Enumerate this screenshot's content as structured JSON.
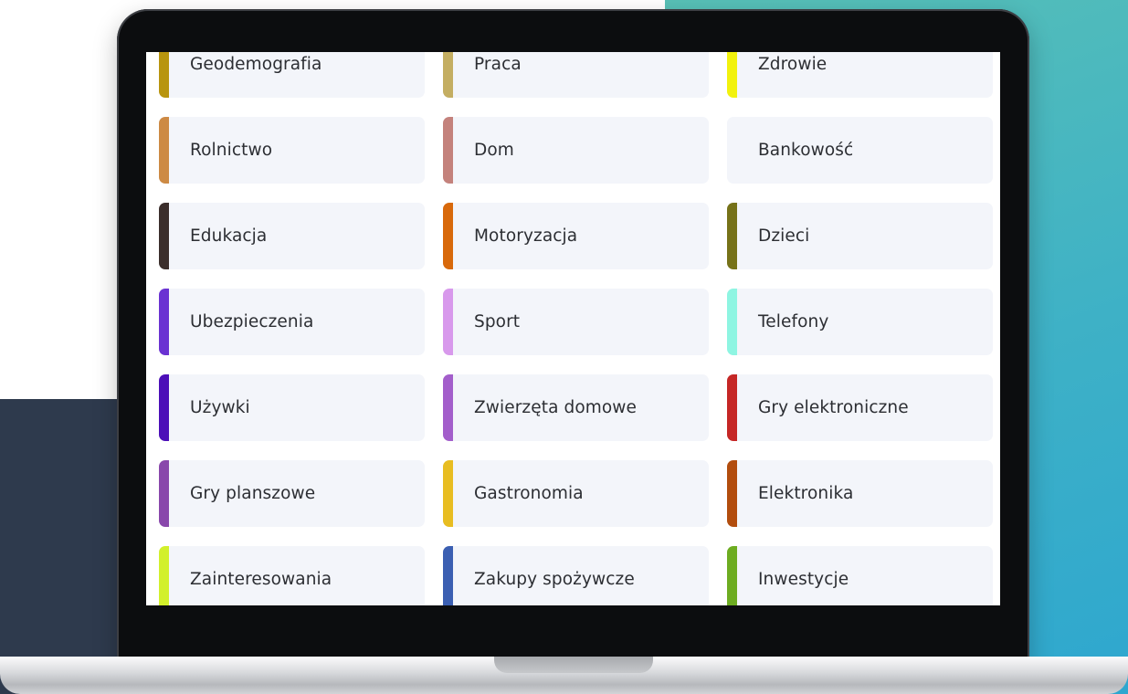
{
  "categories": [
    {
      "label": "Geodemografia",
      "color": "#b8950f"
    },
    {
      "label": "Praca",
      "color": "#c4ae62"
    },
    {
      "label": "Zdrowie",
      "color": "#f2f20e"
    },
    {
      "label": "Rolnictwo",
      "color": "#cd8a44"
    },
    {
      "label": "Dom",
      "color": "#c4827c"
    },
    {
      "label": "Bankowość",
      "color": ""
    },
    {
      "label": "Edukacja",
      "color": "#3b2e2b"
    },
    {
      "label": "Motoryzacja",
      "color": "#d8690b"
    },
    {
      "label": "Dzieci",
      "color": "#767219"
    },
    {
      "label": "Ubezpieczenia",
      "color": "#6a32d2"
    },
    {
      "label": "Sport",
      "color": "#d899ec"
    },
    {
      "label": "Telefony",
      "color": "#8ef5e2"
    },
    {
      "label": "Używki",
      "color": "#4c0fb8"
    },
    {
      "label": "Zwierzęta domowe",
      "color": "#a35ecb"
    },
    {
      "label": "Gry elektroniczne",
      "color": "#c52726"
    },
    {
      "label": "Gry planszowe",
      "color": "#8947ab"
    },
    {
      "label": "Gastronomia",
      "color": "#e8bd21"
    },
    {
      "label": "Elektronika",
      "color": "#b24d0e"
    },
    {
      "label": "Zainteresowania",
      "color": "#d2f02b"
    },
    {
      "label": "Zakupy spożywcze",
      "color": "#3b5fb2"
    },
    {
      "label": "Inwestycje",
      "color": "#6dac21"
    }
  ]
}
